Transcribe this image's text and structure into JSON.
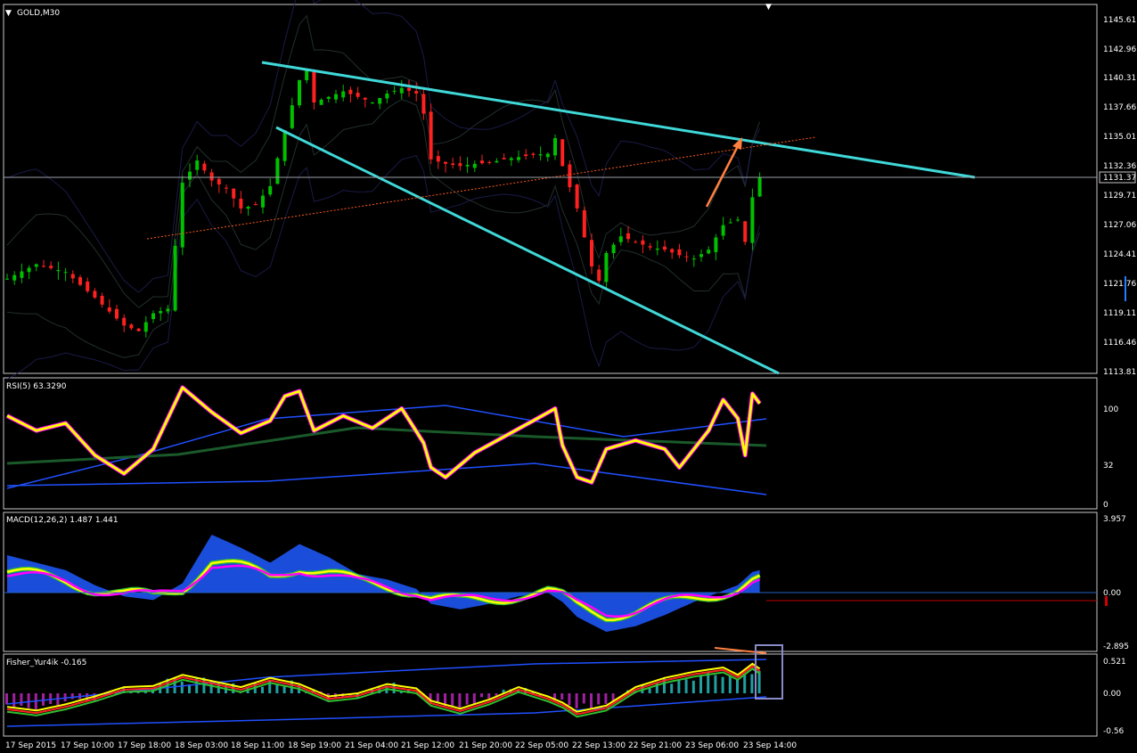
{
  "window": {
    "symbol_label": "GOLD,M30"
  },
  "colors": {
    "background": "#000000",
    "frame": "#c8c8c8",
    "bull_candle": "#00c000",
    "bear_candle": "#ff2020",
    "trendline": "#40d8d8",
    "dotted_line": "#ff5a1f",
    "arrow": "#ff8040",
    "rsi_main": "#ffff00",
    "rsi_halo": "#ff00ff",
    "macd_hist": "#1e5aff",
    "macd_fast": "#ffff00",
    "macd_slow": "#ff00ff",
    "fisher_pos": "#20a0a0",
    "fisher_neg": "#a020a0",
    "current_price_box": "#000000"
  },
  "price_axis": {
    "ticks": [
      "1145.61",
      "1142.96",
      "1140.31",
      "1137.66",
      "1135.01",
      "1132.36",
      "1129.71",
      "1127.06",
      "1124.41",
      "1121.76",
      "1119.11",
      "1116.46",
      "1113.81"
    ],
    "current_price": "1131.37"
  },
  "rsi": {
    "label": "RSI(5) 63.3290",
    "levels": [
      "100",
      "32",
      "0"
    ]
  },
  "macd": {
    "label": "MACD(12,26,2) 1.487 1.441",
    "levels": [
      "3.957",
      "0.00",
      "-2.895"
    ]
  },
  "fisher": {
    "label": "Fisher_Yur4ik -0.165",
    "levels": [
      "0.521",
      "0.00",
      "-0.56"
    ]
  },
  "time_axis": {
    "labels": [
      "17 Sep 2015",
      "17 Sep 10:00",
      "17 Sep 18:00",
      "18 Sep 03:00",
      "18 Sep 11:00",
      "18 Sep 19:00",
      "21 Sep 04:00",
      "21 Sep 12:00",
      "21 Sep 20:00",
      "22 Sep 05:00",
      "22 Sep 13:00",
      "22 Sep 21:00",
      "23 Sep 06:00",
      "23 Sep 14:00"
    ]
  },
  "chart_data": {
    "type": "candlestick",
    "symbol": "GOLD",
    "timeframe": "M30",
    "ylim": [
      1113.81,
      1145.61
    ],
    "close_path": [
      [
        0,
        1122.3
      ],
      [
        4,
        1123.6
      ],
      [
        8,
        1122.9
      ],
      [
        12,
        1120.6
      ],
      [
        16,
        1118.1
      ],
      [
        18,
        1117.6
      ],
      [
        20,
        1119.2
      ],
      [
        22,
        1119.6
      ],
      [
        24,
        1130.9
      ],
      [
        26,
        1132.9
      ],
      [
        28,
        1131.1
      ],
      [
        30,
        1130.4
      ],
      [
        32,
        1128.6
      ],
      [
        34,
        1128.9
      ],
      [
        36,
        1130.6
      ],
      [
        38,
        1135.6
      ],
      [
        40,
        1140.1
      ],
      [
        41,
        1141.0
      ],
      [
        42,
        1138.1
      ],
      [
        44,
        1138.6
      ],
      [
        46,
        1139.1
      ],
      [
        48,
        1138.6
      ],
      [
        50,
        1138.1
      ],
      [
        52,
        1138.9
      ],
      [
        54,
        1139.4
      ],
      [
        56,
        1138.9
      ],
      [
        57,
        1137.1
      ],
      [
        58,
        1133.0
      ],
      [
        60,
        1132.6
      ],
      [
        62,
        1132.4
      ],
      [
        64,
        1132.6
      ],
      [
        66,
        1132.7
      ],
      [
        68,
        1133.0
      ],
      [
        70,
        1133.2
      ],
      [
        72,
        1133.4
      ],
      [
        74,
        1133.5
      ],
      [
        75,
        1134.9
      ],
      [
        76,
        1132.4
      ],
      [
        78,
        1128.6
      ],
      [
        80,
        1123.4
      ],
      [
        81,
        1122.1
      ],
      [
        82,
        1124.6
      ],
      [
        84,
        1126.1
      ],
      [
        86,
        1125.6
      ],
      [
        88,
        1125.1
      ],
      [
        90,
        1124.9
      ],
      [
        92,
        1124.4
      ],
      [
        94,
        1124.1
      ],
      [
        96,
        1124.9
      ],
      [
        98,
        1127.1
      ],
      [
        100,
        1127.6
      ],
      [
        101,
        1125.6
      ],
      [
        102,
        1129.6
      ],
      [
        103,
        1131.4
      ]
    ],
    "rsi_path": [
      [
        0,
        72
      ],
      [
        4,
        60
      ],
      [
        8,
        66
      ],
      [
        12,
        40
      ],
      [
        16,
        25
      ],
      [
        20,
        45
      ],
      [
        24,
        95
      ],
      [
        28,
        75
      ],
      [
        32,
        58
      ],
      [
        36,
        68
      ],
      [
        38,
        88
      ],
      [
        40,
        92
      ],
      [
        42,
        60
      ],
      [
        46,
        72
      ],
      [
        50,
        62
      ],
      [
        54,
        78
      ],
      [
        57,
        50
      ],
      [
        58,
        30
      ],
      [
        60,
        22
      ],
      [
        64,
        42
      ],
      [
        68,
        55
      ],
      [
        72,
        68
      ],
      [
        75,
        78
      ],
      [
        76,
        48
      ],
      [
        78,
        22
      ],
      [
        80,
        18
      ],
      [
        82,
        45
      ],
      [
        86,
        52
      ],
      [
        90,
        45
      ],
      [
        92,
        30
      ],
      [
        96,
        60
      ],
      [
        98,
        85
      ],
      [
        100,
        70
      ],
      [
        101,
        40
      ],
      [
        102,
        90
      ],
      [
        103,
        82
      ]
    ],
    "macd_histogram": [
      [
        0,
        2.0
      ],
      [
        4,
        1.6
      ],
      [
        8,
        1.2
      ],
      [
        12,
        0.4
      ],
      [
        16,
        -0.2
      ],
      [
        20,
        -0.4
      ],
      [
        24,
        0.5
      ],
      [
        28,
        3.1
      ],
      [
        32,
        2.4
      ],
      [
        36,
        1.6
      ],
      [
        40,
        2.6
      ],
      [
        44,
        1.9
      ],
      [
        48,
        1.0
      ],
      [
        52,
        0.7
      ],
      [
        56,
        0.2
      ],
      [
        58,
        -0.6
      ],
      [
        62,
        -0.9
      ],
      [
        66,
        -0.6
      ],
      [
        70,
        -0.2
      ],
      [
        74,
        0.0
      ],
      [
        76,
        -0.5
      ],
      [
        78,
        -1.3
      ],
      [
        82,
        -2.1
      ],
      [
        86,
        -1.8
      ],
      [
        90,
        -1.2
      ],
      [
        94,
        -0.5
      ],
      [
        98,
        0.1
      ],
      [
        100,
        0.4
      ],
      [
        102,
        1.1
      ],
      [
        103,
        1.2
      ]
    ],
    "fisher_values": [
      [
        0,
        -0.22
      ],
      [
        4,
        -0.28
      ],
      [
        8,
        -0.18
      ],
      [
        12,
        -0.05
      ],
      [
        16,
        0.1
      ],
      [
        20,
        0.12
      ],
      [
        24,
        0.3
      ],
      [
        28,
        0.2
      ],
      [
        32,
        0.1
      ],
      [
        36,
        0.25
      ],
      [
        40,
        0.15
      ],
      [
        44,
        -0.05
      ],
      [
        48,
        0.0
      ],
      [
        52,
        0.15
      ],
      [
        56,
        0.08
      ],
      [
        58,
        -0.12
      ],
      [
        62,
        -0.25
      ],
      [
        66,
        -0.1
      ],
      [
        70,
        0.1
      ],
      [
        74,
        -0.05
      ],
      [
        76,
        -0.15
      ],
      [
        78,
        -0.3
      ],
      [
        82,
        -0.2
      ],
      [
        86,
        0.1
      ],
      [
        90,
        0.25
      ],
      [
        94,
        0.35
      ],
      [
        98,
        0.42
      ],
      [
        100,
        0.3
      ],
      [
        102,
        0.48
      ],
      [
        103,
        0.4
      ]
    ]
  }
}
